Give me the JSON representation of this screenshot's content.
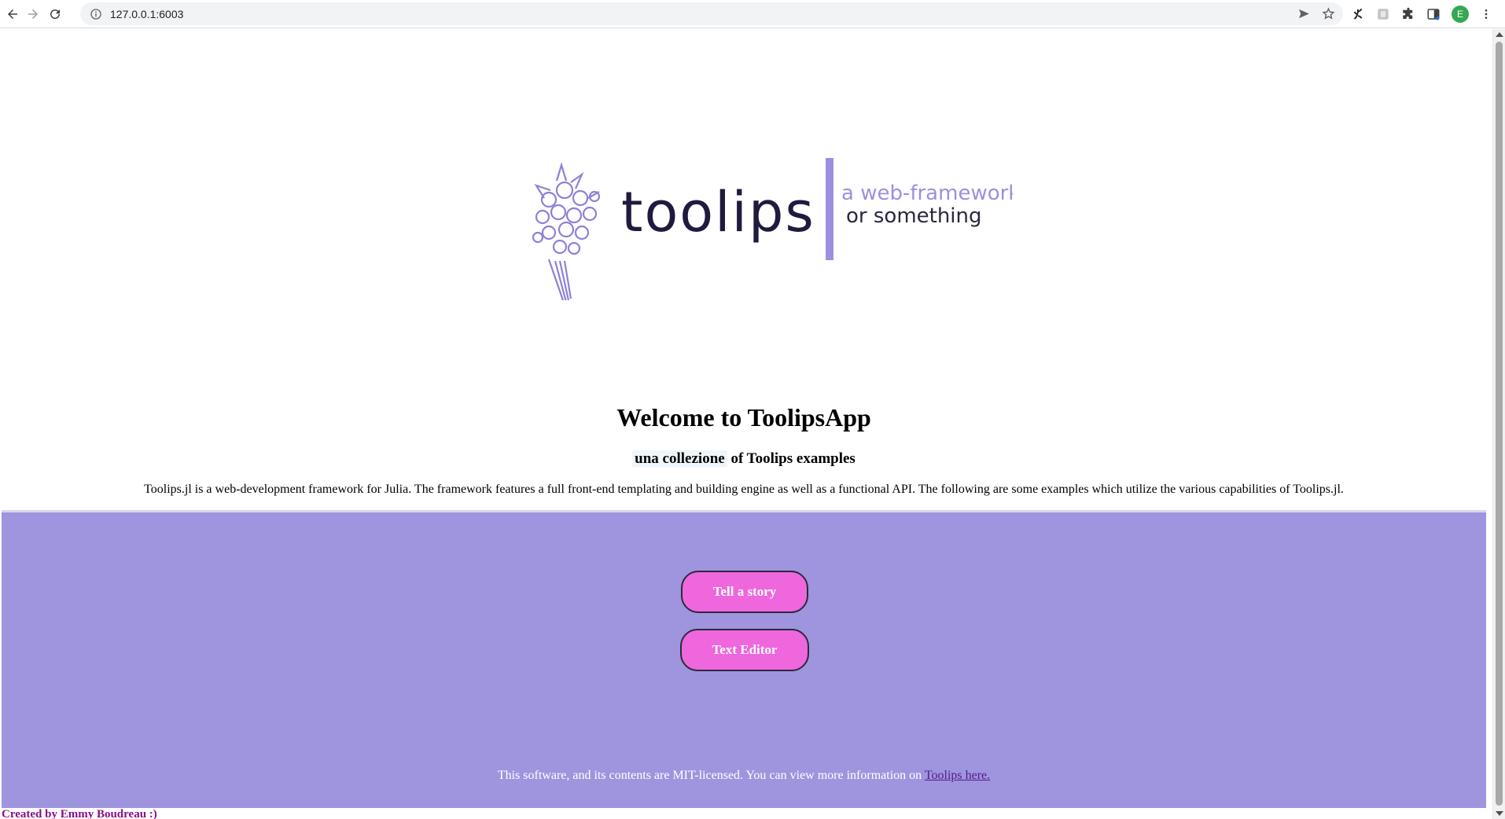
{
  "browser": {
    "url": "127.0.0.1:6003",
    "avatar_letter": "E"
  },
  "logo": {
    "wordmark": "toolips",
    "tagline_line1": "a web-framework",
    "tagline_line2": "or something"
  },
  "page": {
    "title": "Welcome to ToolipsApp",
    "subtitle_highlight": "una collezione",
    "subtitle_rest": " of Toolips examples",
    "intro": "Toolips.jl is a web-development framework for Julia. The framework features a full front-end templating and building engine as well as a functional API. The following are some examples which utilize the various capabilities of Toolips.jl."
  },
  "buttons": {
    "story_label": "Tell a story",
    "editor_label": "Text Editor"
  },
  "footer": {
    "text": "This software, and its contents are MIT-licensed. You can view more information on ",
    "link_text": "Toolips here."
  },
  "credits": "Created by Emmy Boudreau :)",
  "colors": {
    "section_bg": "#9f94de",
    "button_bg": "#ee67dd",
    "logo_dark": "#1e1b3e",
    "logo_accent": "#9d8fe0",
    "credits": "#8a0e8a"
  }
}
